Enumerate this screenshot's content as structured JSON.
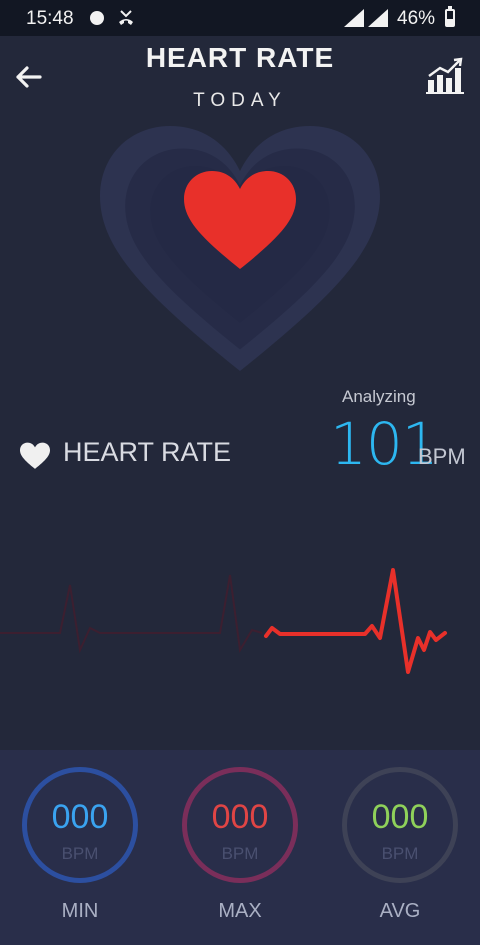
{
  "status_bar": {
    "time": "15:48",
    "battery_percent": "46%",
    "battery_level": 0.46
  },
  "header": {
    "title": "HEART RATE",
    "subtitle": "TODAY",
    "back_icon": "arrow-left-icon",
    "stats_icon": "bar-chart-icon"
  },
  "reading": {
    "status": "Analyzing",
    "value": "101",
    "unit": "BPM",
    "color": "#2db7f0"
  },
  "section": {
    "label": "HEART RATE",
    "icon": "heart-icon"
  },
  "colors": {
    "background": "#23283a",
    "heart": "#e8302a",
    "ecg_active": "#e8302a"
  },
  "stats": [
    {
      "value": "000",
      "unit": "BPM",
      "label": "MIN",
      "color": "#3aa3f0",
      "ring": "#2c4fa0"
    },
    {
      "value": "000",
      "unit": "BPM",
      "label": "MAX",
      "color": "#e04545",
      "ring": "#7a2e5a"
    },
    {
      "value": "000",
      "unit": "BPM",
      "label": "AVG",
      "color": "#8fd15a",
      "ring": "#3e4256"
    }
  ]
}
